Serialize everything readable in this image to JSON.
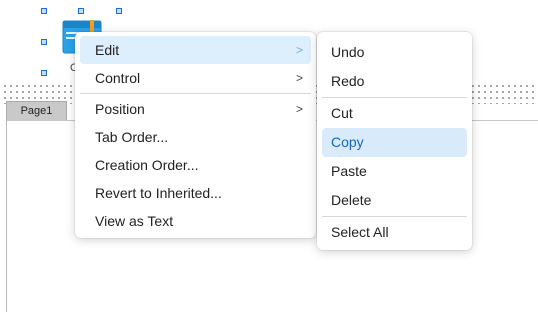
{
  "canvas": {
    "page_tab": "Page1",
    "control_caption": "C"
  },
  "menu": {
    "items": [
      {
        "label": "Edit",
        "submenu": true,
        "highlighted": true
      },
      {
        "label": "Control",
        "submenu": true
      },
      {
        "label": "Position",
        "submenu": true
      },
      {
        "label": "Tab Order..."
      },
      {
        "label": "Creation Order..."
      },
      {
        "label": "Revert to Inherited..."
      },
      {
        "label": "View as Text"
      }
    ],
    "submenu_arrow": ">"
  },
  "submenu": {
    "items": [
      {
        "label": "Undo"
      },
      {
        "label": "Redo"
      },
      {
        "label": "Cut"
      },
      {
        "label": "Copy",
        "highlighted": true
      },
      {
        "label": "Paste"
      },
      {
        "label": "Delete"
      },
      {
        "label": "Select All"
      }
    ]
  },
  "colors": {
    "highlight": "#ddeefc",
    "copy_text": "#1565c0",
    "handle_border": "#1b6fd6"
  }
}
